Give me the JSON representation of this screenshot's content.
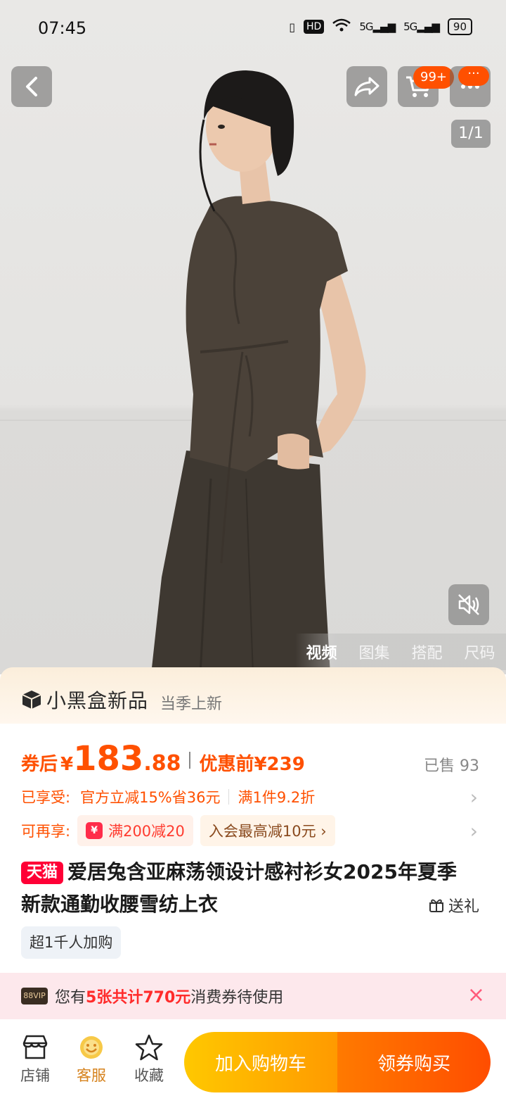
{
  "status_bar": {
    "time": "07:45",
    "hd_label": "HD",
    "signal_1": "5G",
    "signal_2": "5G",
    "battery": "90"
  },
  "gallery": {
    "cart_badge": "99+",
    "more_badge": "···",
    "page_indicator": "1/1",
    "media_tabs": [
      "视频",
      "图集",
      "搭配",
      "尺码"
    ],
    "active_media_tab": "视频"
  },
  "promo": {
    "logo_text": "小黑盒新品",
    "subtitle": "当季上新"
  },
  "price": {
    "prefix": "券后",
    "currency": "¥",
    "integer": "183",
    "decimal": ".88",
    "original_label": "优惠前¥239",
    "sold": "已售 93"
  },
  "discounts": {
    "enjoyed_label": "已享受:",
    "enjoyed_1": "官方立减15%省36元",
    "enjoyed_2": "满1件9.2折",
    "more_label": "可再享:",
    "coupon_icon": "¥",
    "coupon_chip": "满200减20",
    "member_chip": "入会最高减10元 ›"
  },
  "product": {
    "store_tag": "天猫",
    "title": "爱居兔含亚麻荡领设计感衬衫女2025年夏季新款通勤收腰雪纺上衣",
    "gift_label": "送礼",
    "hot_tag": "超1千人加购"
  },
  "notice": {
    "vip_label": "88VIP",
    "text_before": "您有",
    "highlight": "5张共计770元",
    "text_after": "消费券待使用",
    "close": "×"
  },
  "bottom_bar": {
    "store": "店铺",
    "service": "客服",
    "favorite": "收藏",
    "add_to_cart": "加入购物车",
    "buy": "领券购买"
  },
  "colors": {
    "accent": "#ff5000",
    "tmall_red": "#ff0036",
    "cart_yellow": "#ffb400",
    "buy_orange": "#ff5a00"
  }
}
